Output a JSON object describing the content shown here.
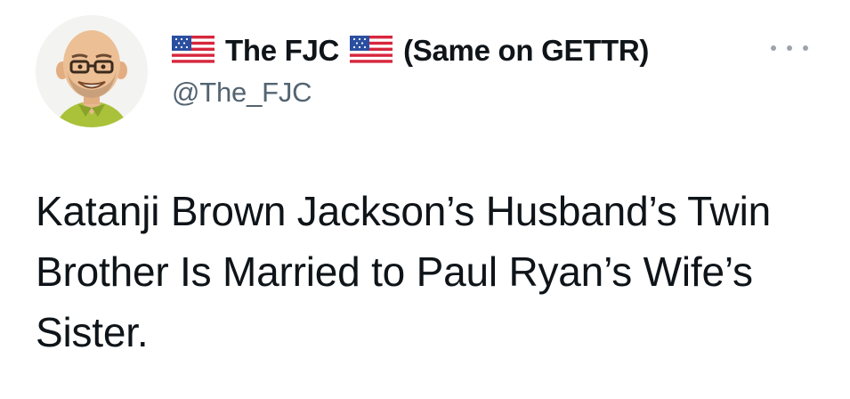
{
  "author": {
    "display_name_main": "The FJC",
    "display_name_suffix": "(Same on GETTR)",
    "handle": "@The_FJC",
    "flag_icon": "us-flag-emoji",
    "avatar_icon": "cartoon-bald-man-glasses-avatar"
  },
  "tweet": {
    "text": "Katanji Brown Jackson’s Husband’s Twin Brother Is Married to Paul Ryan’s Wife’s Sister."
  },
  "menu": {
    "icon": "more-options-ellipsis-icon"
  },
  "colors": {
    "text": "#0f1419",
    "secondary": "#536471",
    "background": "#ffffff"
  }
}
